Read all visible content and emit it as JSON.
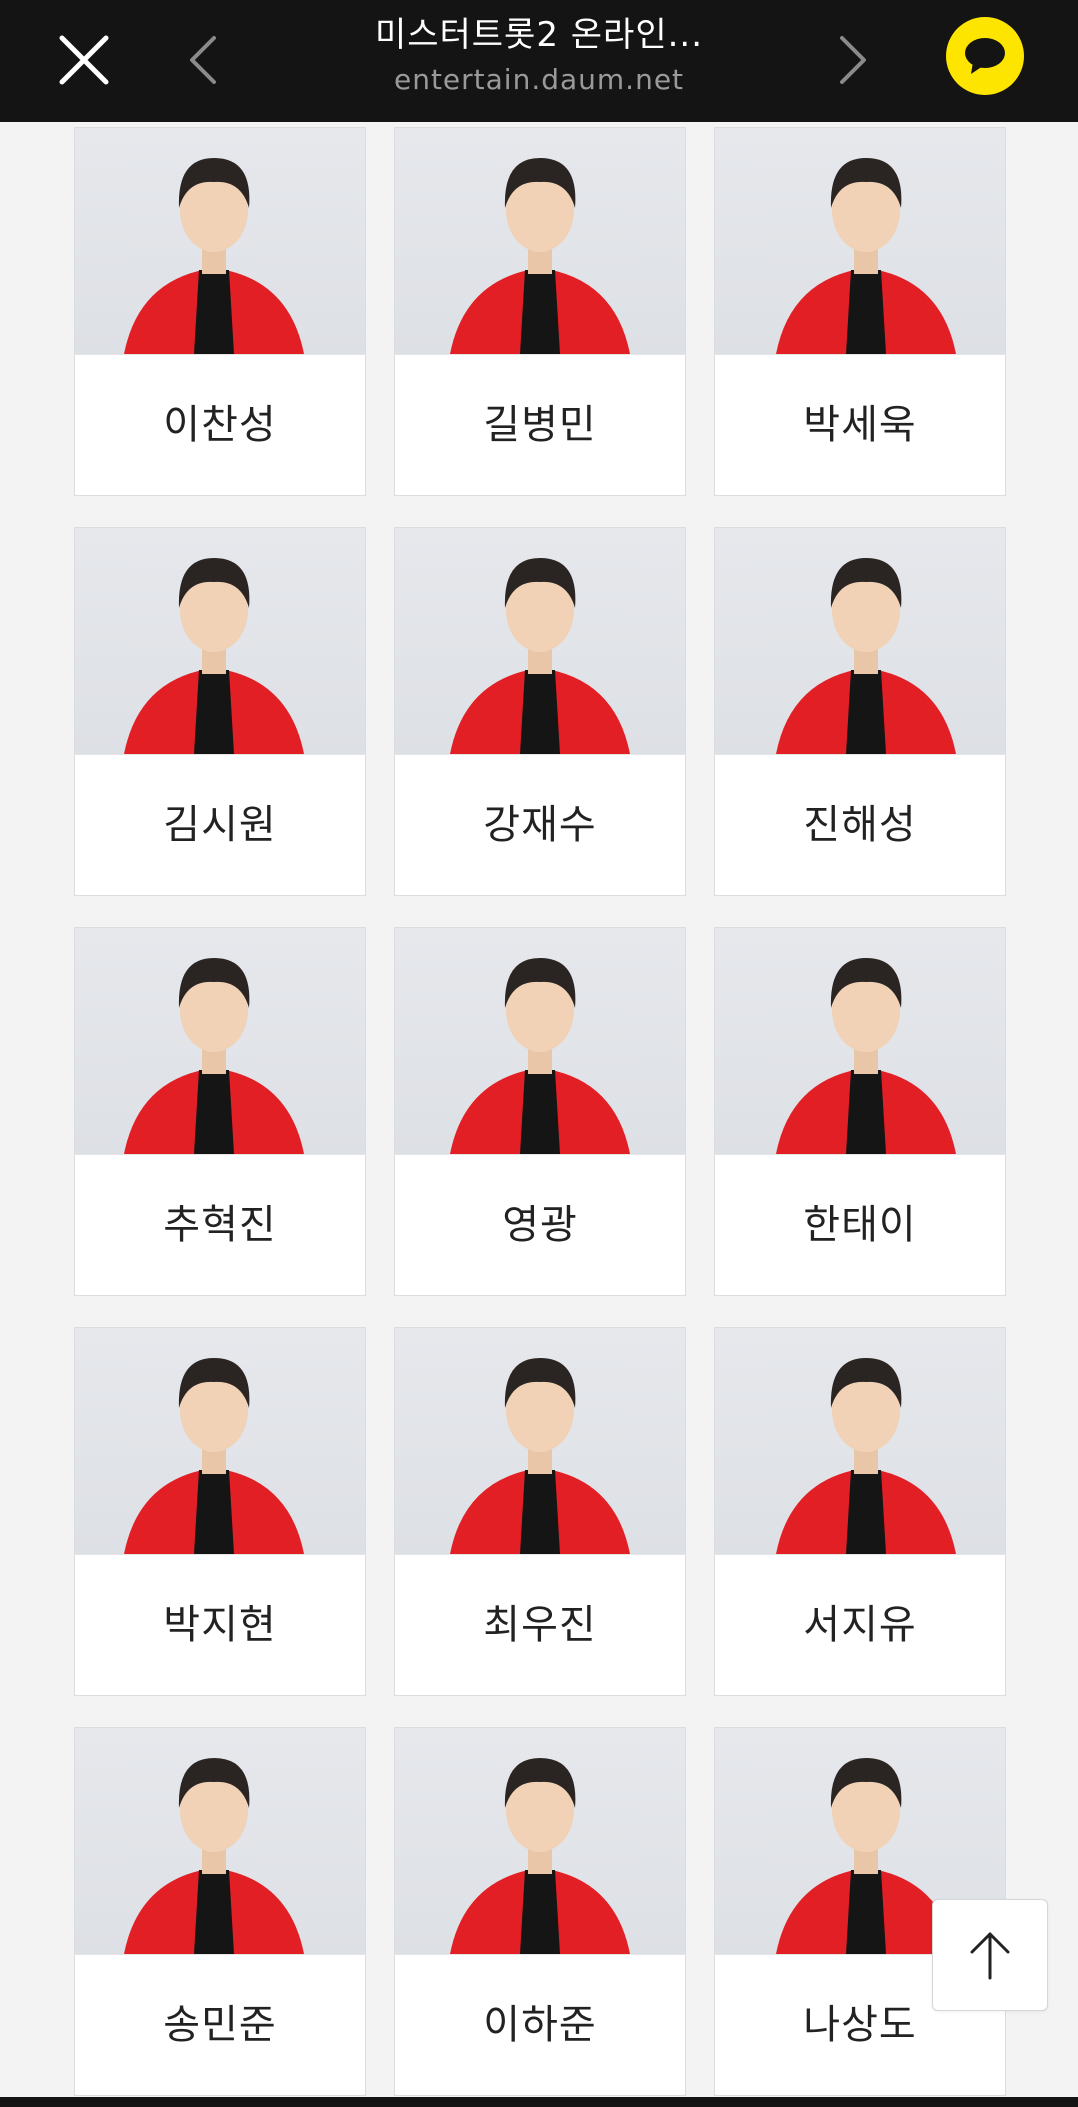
{
  "header": {
    "title": "미스터트롯2 온라인...",
    "url": "entertain.daum.net",
    "icons": {
      "close": "close-icon",
      "prev": "chevron-left-icon",
      "next": "chevron-right-icon",
      "share": "kakaotalk-chat-icon"
    },
    "colors": {
      "bar": "#141414",
      "share_button": "#fee500"
    }
  },
  "contestants": [
    {
      "name": "이찬성"
    },
    {
      "name": "길병민"
    },
    {
      "name": "박세욱"
    },
    {
      "name": "김시원"
    },
    {
      "name": "강재수"
    },
    {
      "name": "진해성"
    },
    {
      "name": "추혁진"
    },
    {
      "name": "영광"
    },
    {
      "name": "한태이"
    },
    {
      "name": "박지현"
    },
    {
      "name": "최우진"
    },
    {
      "name": "서지유"
    },
    {
      "name": "송민준"
    },
    {
      "name": "이하준"
    },
    {
      "name": "나상도"
    }
  ],
  "scroll_top": {
    "icon": "arrow-up-icon"
  },
  "colors": {
    "page_background": "#f3f3f4",
    "jacket_red": "#e21f25"
  }
}
